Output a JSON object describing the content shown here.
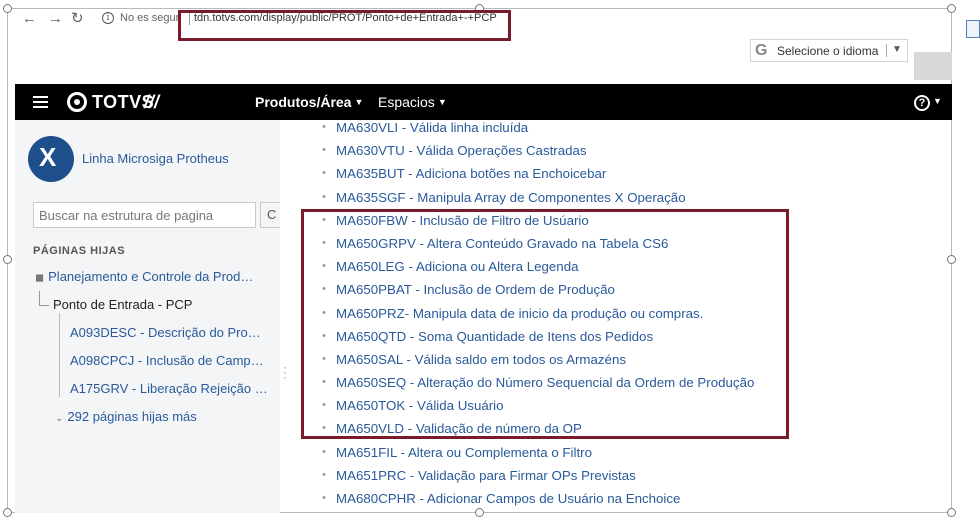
{
  "browser": {
    "back_icon": "arrow-left-icon",
    "forward_icon": "arrow-right-icon",
    "reload_icon": "reload-icon",
    "security_text": "No es segur",
    "url": "tdn.totvs.com/display/public/PROT/Ponto+de+Entrada+-+PCP"
  },
  "translate": {
    "label": "Selecione o idioma",
    "g_letter": "G"
  },
  "nav": {
    "logo_text": "TOTVS",
    "logo_slashes": "///",
    "produtos": "Produtos/Área",
    "espacios": "Espacios",
    "help": "?"
  },
  "sidebar": {
    "space_name": "Linha Microsiga Protheus",
    "search_placeholder": "Buscar na estrutura de pagina",
    "search_btn": "C",
    "child_heading": "PÁGINAS HIJAS",
    "parent_page": "Planejamento e Controle da Prod…",
    "current_page": "Ponto de Entrada - PCP",
    "children": [
      {
        "code": "A093DESC",
        "desc": " - Descrição do Pro…"
      },
      {
        "code": "A098CPCJ",
        "desc": " - Inclusão de Camp…"
      },
      {
        "code": "A175GRV",
        "desc": " - Liberação Rejeição …"
      }
    ],
    "more_children": "292 páginas hijas más"
  },
  "main": {
    "items": [
      {
        "code": "MA630VLI",
        "desc": " - Válida linha incluída"
      },
      {
        "code": "MA630VTU",
        "desc": " - Válida Operações Castradas"
      },
      {
        "code": "MA635BUT",
        "desc": " - Adiciona botões na Enchoicebar"
      },
      {
        "code": "MA635SGF",
        "desc": " - Manipula Array de Componentes X Operação"
      },
      {
        "code": "MA650FBW",
        "desc": " - Inclusão de Filtro de Usúario"
      },
      {
        "code": "MA650GRPV",
        "desc": " - Altera Conteúdo Gravado na Tabela CS6"
      },
      {
        "code": "MA650LEG",
        "desc": " - Adiciona ou Altera Legenda"
      },
      {
        "code": "MA650PBAT",
        "desc": " - Inclusão de Ordem de Produção"
      },
      {
        "code": "MA650PRZ",
        "desc": "- Manipula data de inicio da produção ou compras."
      },
      {
        "code": "MA650QTD",
        "desc": " - Soma Quantidade de Itens dos Pedidos"
      },
      {
        "code": "MA650SAL",
        "desc": " - Válida saldo em todos os Armazéns"
      },
      {
        "code": "MA650SEQ",
        "desc": " - Alteração do Número Sequencial da Ordem de Produção"
      },
      {
        "code": "MA650TOK",
        "desc": " - Válida Usuário"
      },
      {
        "code": "MA650VLD",
        "desc": " - Validação de número da OP"
      },
      {
        "code": "MA651FIL",
        "desc": " - Altera ou Complementa o Filtro"
      },
      {
        "code": "MA651PRC",
        "desc": " - Validação para Firmar OPs Previstas"
      },
      {
        "code": "MA680CPHR",
        "desc": " - Adicionar Campos de Usuário na Enchoice"
      }
    ]
  },
  "colors": {
    "highlight": "#7a1b2c",
    "link": "#2a5a9a",
    "nav_bg": "#000000",
    "sidebar_bg": "#f4f5f7"
  }
}
